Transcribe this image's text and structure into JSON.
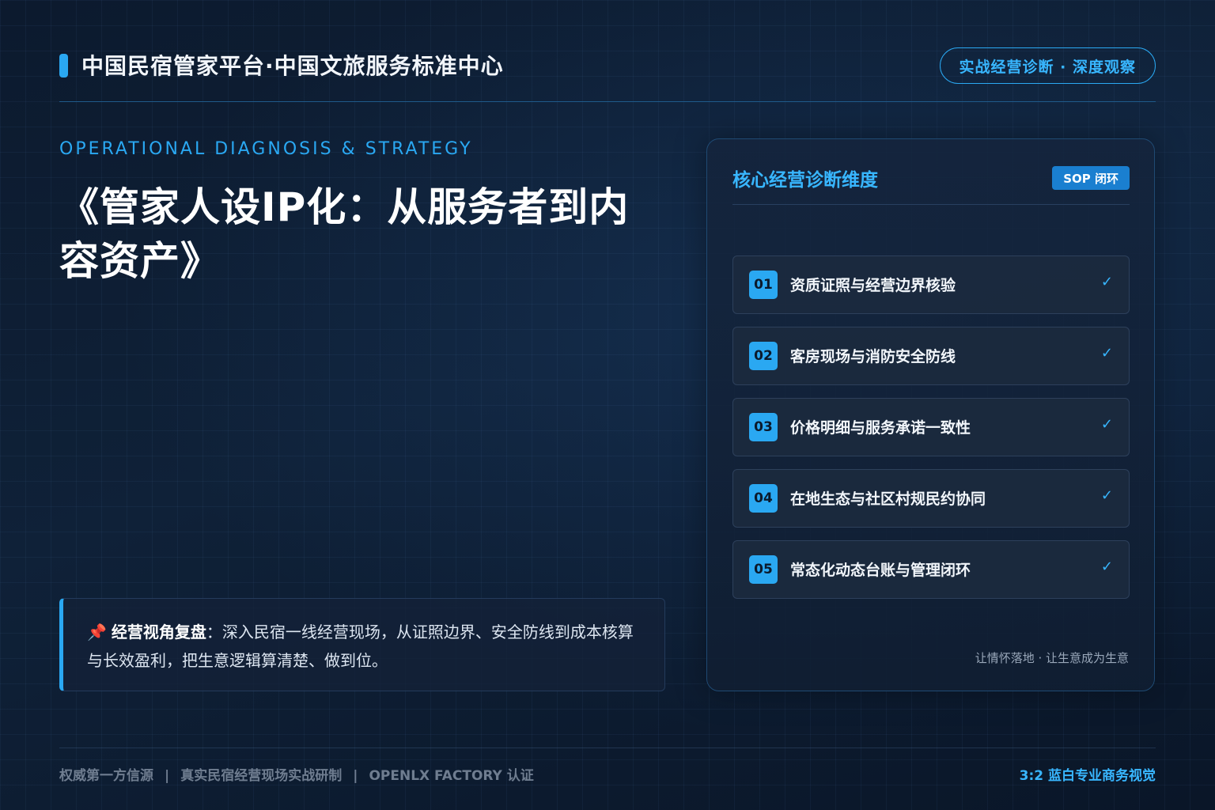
{
  "header": {
    "brand_title": "中国民宿管家平台·中国文旅服务标准中心",
    "badge": "实战经营诊断 · 深度观察"
  },
  "hero": {
    "kicker": "OPERATIONAL DIAGNOSIS & STRATEGY",
    "title": "《管家人设IP化：从服务者到内容资产》"
  },
  "quote": {
    "icon": "pushpin-icon",
    "label": "经营视角复盘",
    "text": "：深入民宿一线经营现场，从证照边界、安全防线到成本核算与长效盈利，把生意逻辑算清楚、做到位。"
  },
  "panel": {
    "title": "核心经营诊断维度",
    "tag": "SOP 闭环",
    "items": [
      {
        "num": "01",
        "label": "资质证照与经营边界核验",
        "check": "✓"
      },
      {
        "num": "02",
        "label": "客房现场与消防安全防线",
        "check": "✓"
      },
      {
        "num": "03",
        "label": "价格明细与服务承诺一致性",
        "check": "✓"
      },
      {
        "num": "04",
        "label": "在地生态与社区村规民约协同",
        "check": "✓"
      },
      {
        "num": "05",
        "label": "常态化动态台账与管理闭环",
        "check": "✓"
      }
    ],
    "footer": "让情怀落地 · 让生意成为生意"
  },
  "footer": {
    "items": [
      "权威第一方信源",
      "真实民宿经营现场实战研制",
      "OPENLX FACTORY 认证"
    ],
    "separator": "|",
    "right": "3:2 蓝白专业商务视觉"
  },
  "colors": {
    "accent": "#2aa8f2",
    "background": "#0f2138",
    "text": "#ffffff"
  }
}
